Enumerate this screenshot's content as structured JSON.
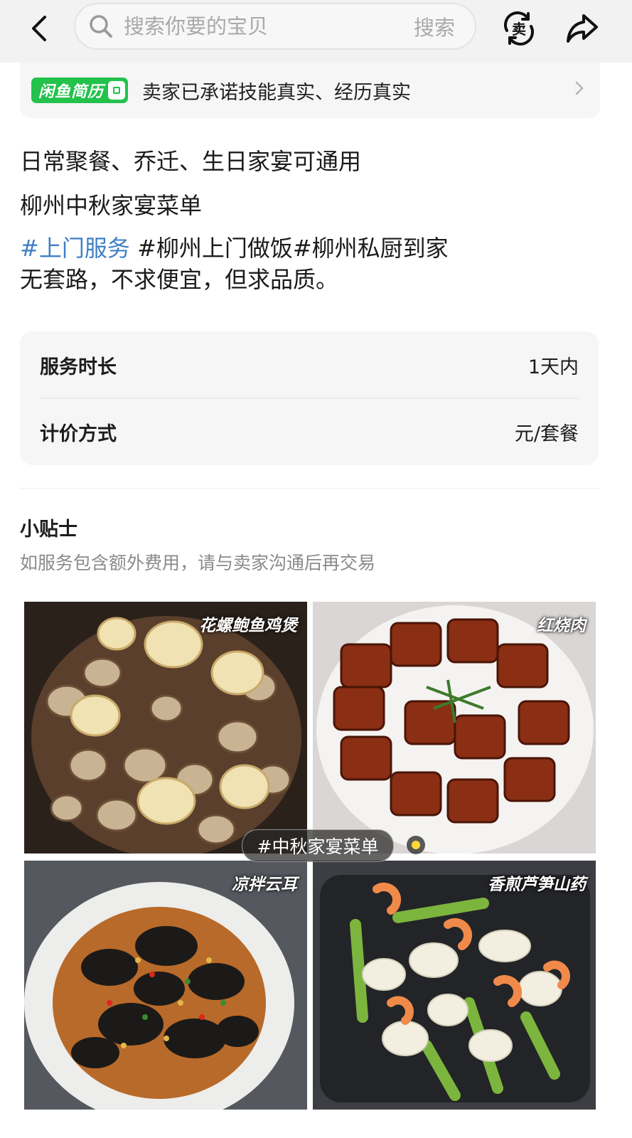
{
  "header": {
    "search_placeholder": "搜索你要的宝贝",
    "search_button": "搜索",
    "sell_icon_char": "卖"
  },
  "resume_banner": {
    "badge": "闲鱼简历",
    "text": "卖家已承诺技能真实、经历真实"
  },
  "description": {
    "line1": "日常聚餐、乔迁、生日家宴可通用",
    "line2": "柳州中秋家宴菜单",
    "tag1": "#上门服务",
    "tag2": " #柳州上门做饭",
    "tag3": "#柳州私厨到家",
    "line4": "无套路，不求便宜，但求品质。"
  },
  "specs": [
    {
      "label": "服务时长",
      "value": "1天内"
    },
    {
      "label": "计价方式",
      "value": "元/套餐"
    }
  ],
  "tips": {
    "title": "小贴士",
    "text": "如服务包含额外费用，请与卖家沟通后再交易"
  },
  "photos": [
    {
      "label": "花螺鲍鱼鸡煲"
    },
    {
      "label": "红烧肉"
    },
    {
      "label": "凉拌云耳"
    },
    {
      "label": "香煎芦笋山药"
    }
  ],
  "photo_tag": "#中秋家宴菜单",
  "colors": {
    "link_blue": "#3f7fc4",
    "brand_green": "#22c24b",
    "tag_dot_yellow": "#ffd83a"
  }
}
